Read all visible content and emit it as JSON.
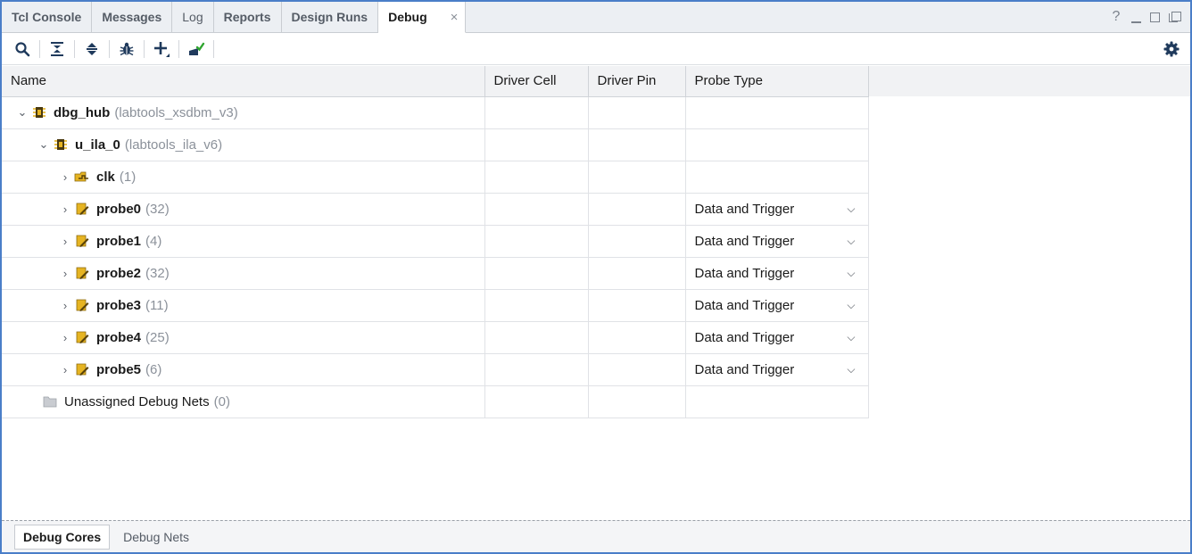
{
  "tabs": [
    {
      "label": "Tcl Console",
      "active": false
    },
    {
      "label": "Messages",
      "active": false
    },
    {
      "label": "Log",
      "active": false
    },
    {
      "label": "Reports",
      "active": false
    },
    {
      "label": "Design Runs",
      "active": false
    },
    {
      "label": "Debug",
      "active": true
    }
  ],
  "tab_close_glyph": "×",
  "window_controls": {
    "help": "?"
  },
  "toolbar": {
    "icons": [
      "search-icon",
      "collapse-all-icon",
      "expand-all-icon",
      "debug-bug-icon",
      "add-icon",
      "assign-icon",
      "settings-gear-icon"
    ]
  },
  "table": {
    "columns": [
      "Name",
      "Driver Cell",
      "Driver Pin",
      "Probe Type"
    ],
    "rows": [
      {
        "chevron": "v",
        "icon": "debug-core-icon",
        "name": "dbg_hub",
        "detail": "(labtools_xsdbm_v3)",
        "driver_cell": "",
        "driver_pin": "",
        "probe_type": ""
      },
      {
        "chevron": "v",
        "icon": "debug-core-icon",
        "name": "u_ila_0",
        "detail": "(labtools_ila_v6)",
        "driver_cell": "",
        "driver_pin": "",
        "probe_type": ""
      },
      {
        "chevron": ">",
        "icon": "clock-net-icon",
        "name": "clk",
        "detail": "(1)",
        "driver_cell": "",
        "driver_pin": "",
        "probe_type": ""
      },
      {
        "chevron": ">",
        "icon": "probe-icon",
        "name": "probe0",
        "detail": "(32)",
        "driver_cell": "",
        "driver_pin": "",
        "probe_type": "Data and Trigger"
      },
      {
        "chevron": ">",
        "icon": "probe-icon",
        "name": "probe1",
        "detail": "(4)",
        "driver_cell": "",
        "driver_pin": "",
        "probe_type": "Data and Trigger"
      },
      {
        "chevron": ">",
        "icon": "probe-icon",
        "name": "probe2",
        "detail": "(32)",
        "driver_cell": "",
        "driver_pin": "",
        "probe_type": "Data and Trigger"
      },
      {
        "chevron": ">",
        "icon": "probe-icon",
        "name": "probe3",
        "detail": "(11)",
        "driver_cell": "",
        "driver_pin": "",
        "probe_type": "Data and Trigger"
      },
      {
        "chevron": ">",
        "icon": "probe-icon",
        "name": "probe4",
        "detail": "(25)",
        "driver_cell": "",
        "driver_pin": "",
        "probe_type": "Data and Trigger"
      },
      {
        "chevron": ">",
        "icon": "probe-icon",
        "name": "probe5",
        "detail": "(6)",
        "driver_cell": "",
        "driver_pin": "",
        "probe_type": "Data and Trigger"
      },
      {
        "chevron": "",
        "icon": "folder-icon",
        "name": "Unassigned Debug Nets",
        "detail": "(0)",
        "driver_cell": "",
        "driver_pin": "",
        "probe_type": ""
      }
    ]
  },
  "bottom_tabs": [
    {
      "label": "Debug Cores",
      "active": true
    },
    {
      "label": "Debug Nets",
      "active": false
    }
  ],
  "colors": {
    "accent_border": "#4a7ec8",
    "gear": "#1f3a5c",
    "probe_icon": "#e6b422"
  }
}
